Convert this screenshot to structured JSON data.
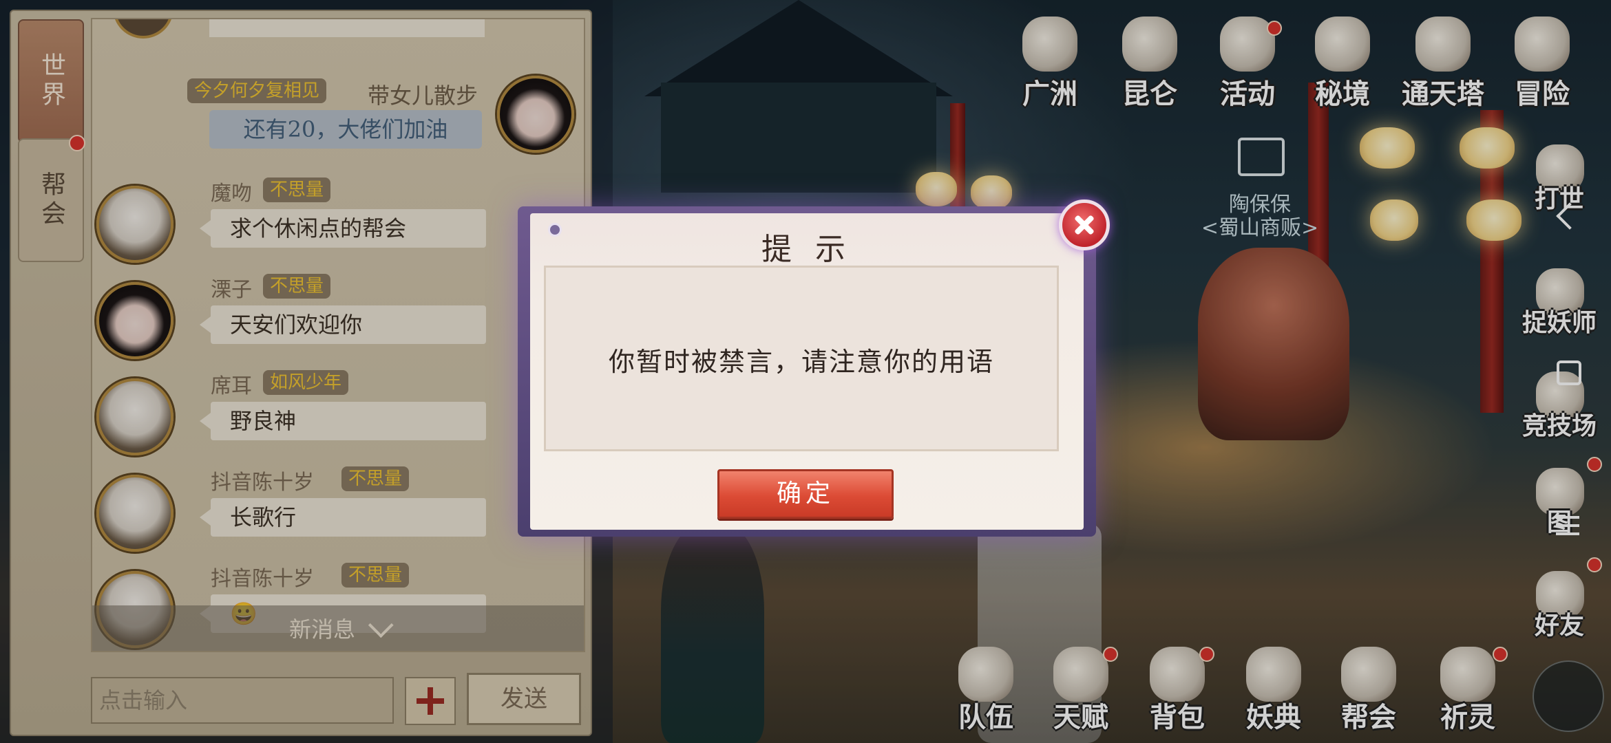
{
  "chat": {
    "tabs": {
      "world": "世界",
      "guild": "帮会"
    },
    "self": {
      "badge": "今夕何夕复相见",
      "name": "带女儿散步",
      "text": "还有20，大佬们加油"
    },
    "messages": [
      {
        "name": "魔吻",
        "badge": "不思量",
        "text": "求个休闲点的帮会"
      },
      {
        "name": "溧子",
        "badge": "不思量",
        "text": "天安们欢迎你"
      },
      {
        "name": "席耳",
        "badge": "如风少年",
        "text": "野良神"
      },
      {
        "name": "抖音陈十岁",
        "badge": "不思量",
        "text": "长歌行"
      },
      {
        "name": "抖音陈十岁",
        "badge": "不思量",
        "text": "😀"
      }
    ],
    "new_messages": "新消息",
    "input_placeholder": "点击输入",
    "send": "发送"
  },
  "top_menu": [
    "广洲",
    "昆仑",
    "活动",
    "秘境",
    "通天塔",
    "冒险"
  ],
  "side_menu": [
    "打世",
    "捉妖师",
    "竞技场",
    "图",
    "好友"
  ],
  "bottom_menu": [
    "队伍",
    "天赋",
    "背包",
    "妖典",
    "帮会",
    "祈灵"
  ],
  "npc": {
    "name": "陶保保",
    "title": "<蜀山商贩>"
  },
  "dialog": {
    "title": "提 示",
    "message": "你暂时被禁言，请注意你的用语",
    "confirm": "确定"
  },
  "colors": {
    "accent": "#dc4b35",
    "badge_text": "#f0c433",
    "frame": "#6f5a8f"
  }
}
